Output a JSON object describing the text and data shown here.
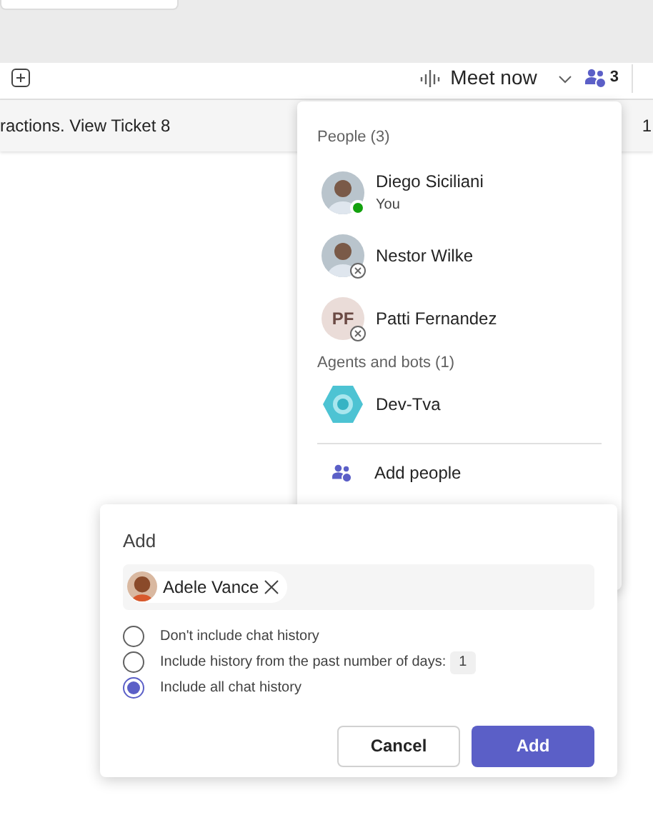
{
  "header": {
    "meet_now": "Meet now",
    "participant_count": "3"
  },
  "message_row": {
    "text": "ractions. View Ticket 8",
    "time": "1"
  },
  "people_menu": {
    "people_heading": "People (3)",
    "people": [
      {
        "name": "Diego Siciliani",
        "subtitle": "You",
        "available": true
      },
      {
        "name": "Nestor Wilke",
        "available": false
      },
      {
        "name": "Patti Fernandez",
        "initials": "PF",
        "available": false
      }
    ],
    "agents_heading": "Agents and bots (1)",
    "agents": [
      {
        "name": "Dev-Tva"
      }
    ],
    "actions": [
      {
        "label": "Add people"
      }
    ]
  },
  "add_dialog": {
    "title": "Add",
    "chips": [
      {
        "name": "Adele Vance"
      }
    ],
    "history_options": [
      {
        "label": "Don't include chat history",
        "selected": false
      },
      {
        "label": "Include history from the past number of days:",
        "days": "1",
        "selected": false
      },
      {
        "label": "Include all chat history",
        "selected": true
      }
    ],
    "buttons": [
      {
        "label": "Cancel",
        "kind": "secondary"
      },
      {
        "label": "Add",
        "kind": "primary"
      }
    ]
  }
}
